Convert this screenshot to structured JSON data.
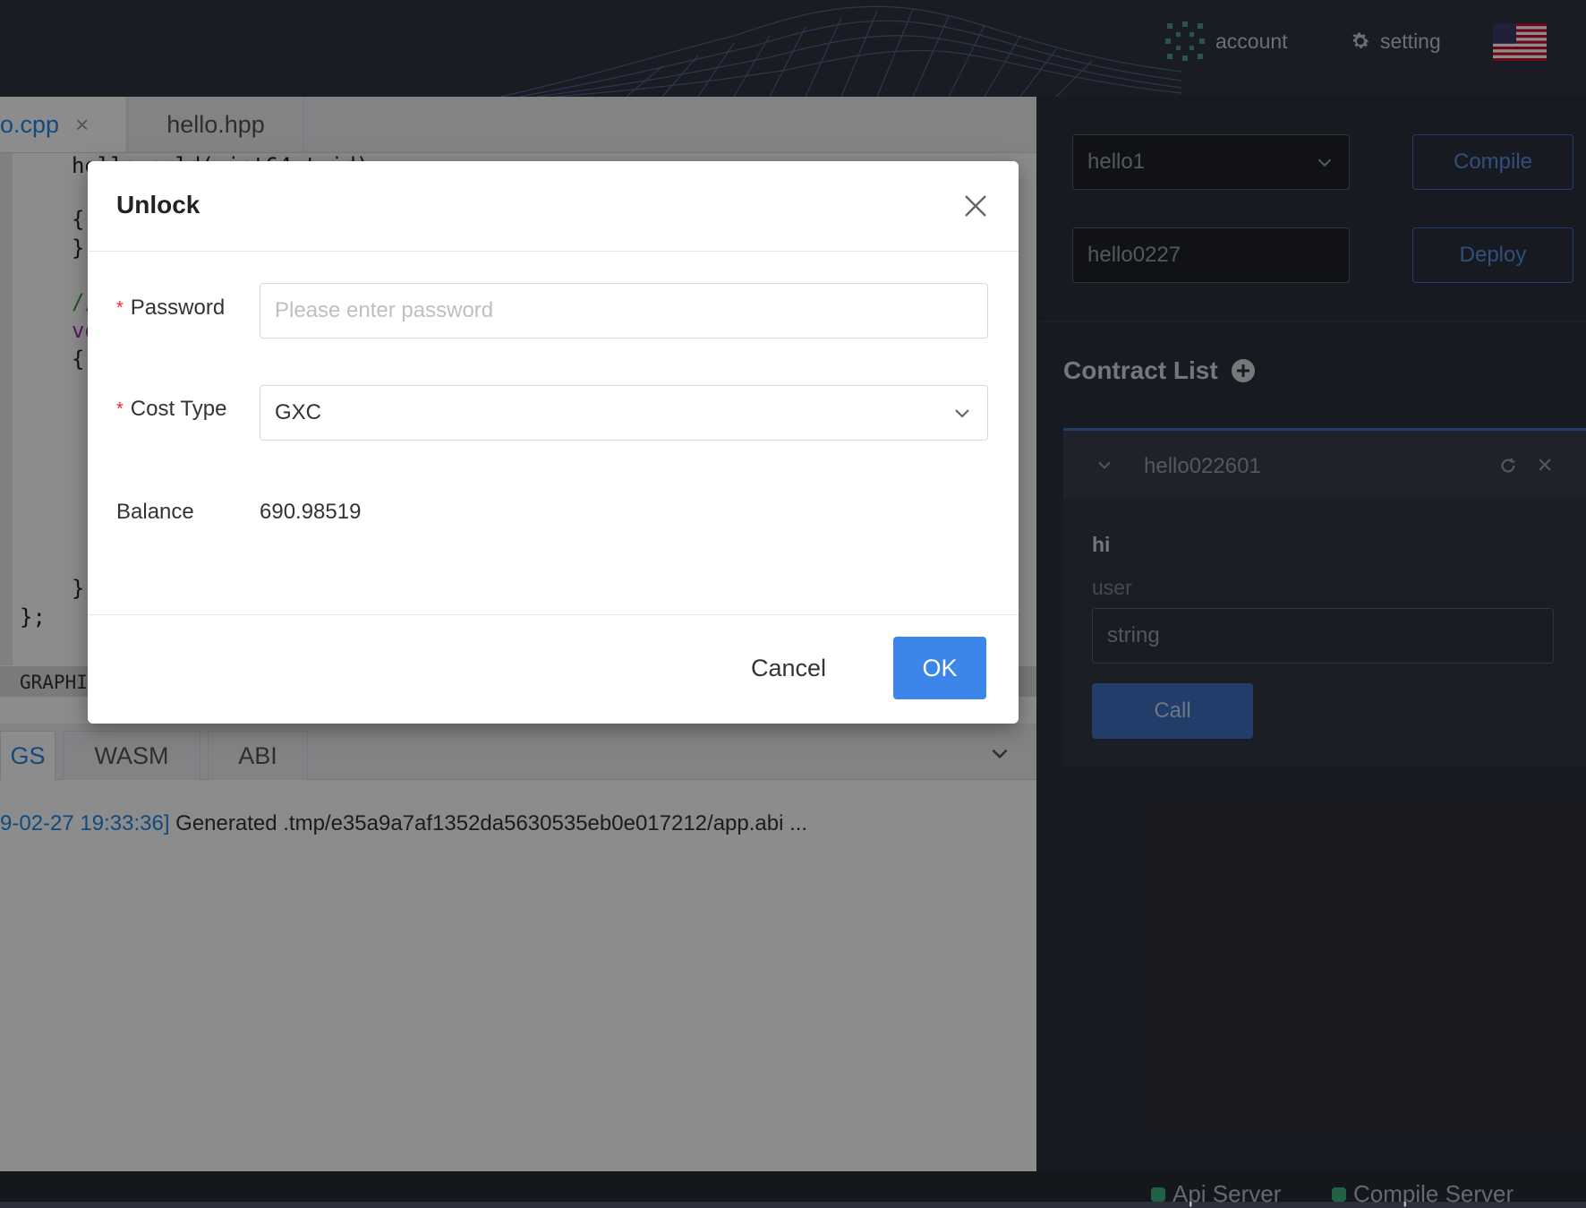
{
  "header": {
    "account_label": "account",
    "setting_label": "setting",
    "language_flag_icon": "us-flag-icon"
  },
  "editor": {
    "tabs": [
      {
        "label": "o.cpp"
      },
      {
        "label": "hello.hpp"
      }
    ],
    "code_lines": [
      "helloworld(uint64_t id)",
      "{",
      "}",
      "//",
      "vo",
      "{",
      "}",
      "};"
    ],
    "graph_label": "GRAPHI"
  },
  "output": {
    "tabs": [
      {
        "label": "GS"
      },
      {
        "label": "WASM"
      },
      {
        "label": "ABI"
      }
    ],
    "log_timestamp": "9-02-27 19:33:36]",
    "log_message": " Generated .tmp/e35a9a7af1352da5630535eb0e017212/app.abi ..."
  },
  "status_bar": {
    "api_server": "Api Server",
    "compile_server": "Compile Server"
  },
  "panel": {
    "contract_select_value": "hello1",
    "compile_label": "Compile",
    "contract_name_value": "hello0227",
    "deploy_label": "Deploy",
    "contract_list_title": "Contract List",
    "card": {
      "name": "hello022601",
      "method": "hi",
      "param_label": "user",
      "param_placeholder": "string",
      "call_label": "Call"
    }
  },
  "modal": {
    "title": "Unlock",
    "password_label": "Password",
    "password_placeholder": "Please enter password",
    "cost_type_label": "Cost Type",
    "cost_type_value": "GXC",
    "balance_label": "Balance",
    "balance_value": "690.98519",
    "cancel_label": "Cancel",
    "ok_label": "OK"
  },
  "colors": {
    "accent": "#3b86e8",
    "topbar": "#2f3441",
    "panel": "#2b303b",
    "required": "#f5222d"
  }
}
